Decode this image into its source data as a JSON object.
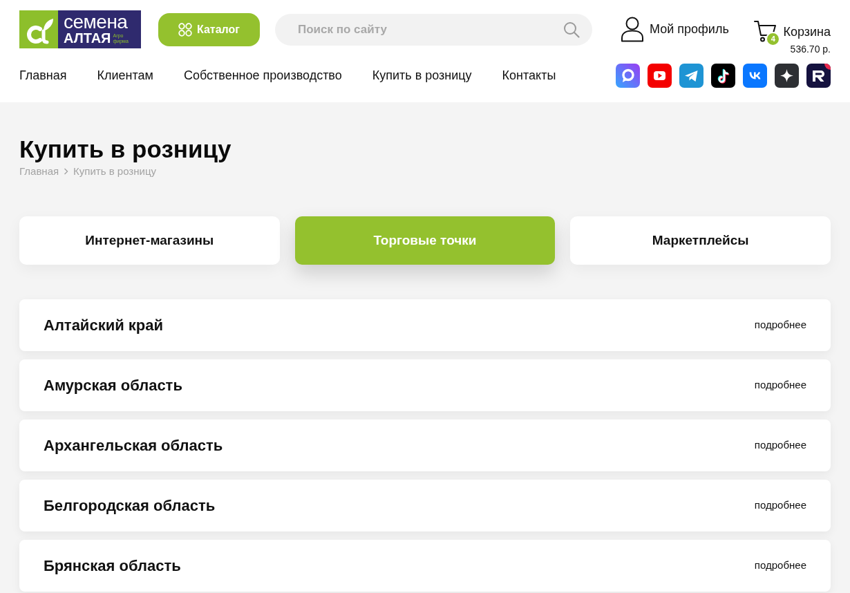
{
  "header": {
    "logo": {
      "brand_line_1": "семена",
      "brand_line_2": "АЛТАЯ",
      "tagline": "Агро фирма"
    },
    "catalog_button": "Каталог",
    "search": {
      "placeholder": "Поиск по сайту"
    },
    "profile_link": "Мой профиль",
    "cart": {
      "label": "Корзина",
      "count": "4",
      "total": "536.70 р."
    }
  },
  "nav": [
    "Главная",
    "Клиентам",
    "Собственное производство",
    "Купить в розницу",
    "Контакты"
  ],
  "page": {
    "title": "Купить в розницу",
    "breadcrumbs": [
      "Главная",
      "Купить в розницу"
    ]
  },
  "tabs": [
    {
      "label": "Интернет-магазины",
      "selected": false
    },
    {
      "label": "Торговые точки",
      "selected": true
    },
    {
      "label": "Маркетплейсы",
      "selected": false
    }
  ],
  "regions": [
    {
      "name": "Алтайский край",
      "link": "подробнее"
    },
    {
      "name": "Амурская область",
      "link": "подробнее"
    },
    {
      "name": "Архангельская область",
      "link": "подробнее"
    },
    {
      "name": "Белгородская область",
      "link": "подробнее"
    },
    {
      "name": "Брянская область",
      "link": "подробнее"
    }
  ]
}
